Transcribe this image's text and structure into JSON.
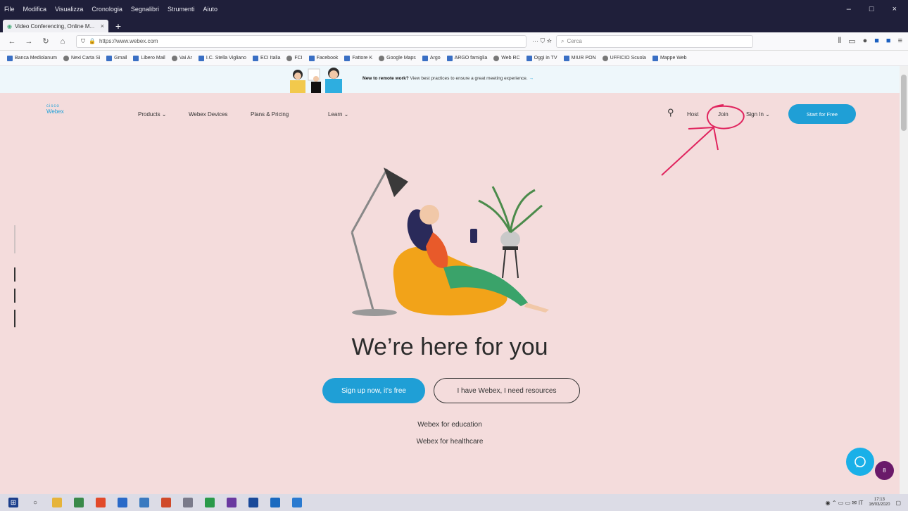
{
  "browser": {
    "menu": [
      "File",
      "Modifica",
      "Visualizza",
      "Cronologia",
      "Segnalibri",
      "Strumenti",
      "Aiuto"
    ],
    "window_controls": [
      "–",
      "□",
      "×"
    ],
    "tab_title": "Video Conferencing, Online M...",
    "tab_close": "×",
    "new_tab": "+",
    "url": "https://www.webex.com",
    "search_placeholder": "Cerca",
    "bookmarks": [
      "Banca Mediolanum",
      "Nexi Carta Si",
      "Gmail",
      "Libero Mail",
      "Vai Ar",
      "I.C. Stella Vigliano",
      "ECI Italia",
      "FCI",
      "Facebook",
      "Fattore K",
      "Google Maps",
      "Argo",
      "ARGO famiglia",
      "Web RC",
      "Oggi in TV",
      "MIUR PON",
      "UFFICIO Scuola",
      "Mappe Web"
    ]
  },
  "banner": {
    "bold_text": "New to remote work?",
    "text": "View best practices to ensure a great meeting experience.",
    "arrow": "→"
  },
  "header": {
    "logo_cisco": "cisco",
    "logo_webex": "Webex",
    "nav": [
      "Products ⌄",
      "Webex Devices",
      "Plans & Pricing",
      "Learn ⌄"
    ],
    "host": "Host",
    "join": "Join",
    "sign_in": "Sign In ⌄",
    "start_free": "Start for Free"
  },
  "hero": {
    "headline": "We’re here for you",
    "cta_primary": "Sign up now, it's free",
    "cta_secondary": "I have Webex, I need resources",
    "link_education": "Webex for education",
    "link_healthcare": "Webex for healthcare"
  },
  "chat_badge": "8",
  "taskbar": {
    "clock_time": "17:13",
    "clock_date": "16/03/2020"
  },
  "colors": {
    "page_bg": "#f4dcdc",
    "accent_blue": "#1f9fd6",
    "annotation_red": "#e0245e",
    "chrome_dark": "#1f1f3a"
  }
}
